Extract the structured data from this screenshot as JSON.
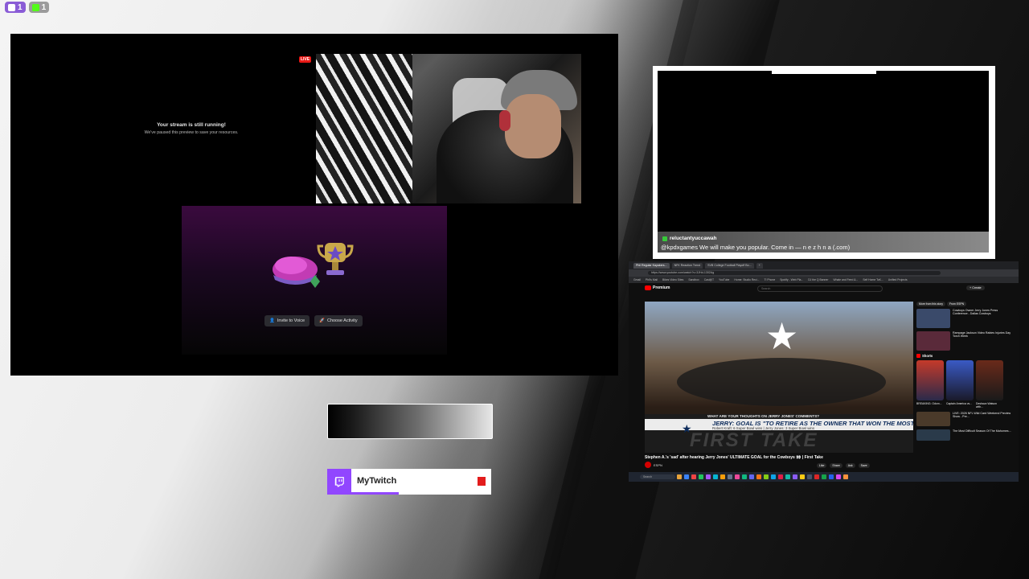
{
  "top_badges": [
    {
      "platform": "twitch",
      "count": "1"
    },
    {
      "platform": "kick",
      "count": "1"
    }
  ],
  "discord_panel": {
    "paused_title": "Your stream is still running!",
    "paused_sub": "We've paused this preview to save your resources.",
    "live_badge": "LIVE",
    "invite_button": "Invite to Voice",
    "choose_activity_button": "Choose Activity"
  },
  "chat": {
    "username": "reluctantyuccawah",
    "message": "@kpdxgames We will make you popular. Come in — n e z h n a (.com)"
  },
  "browser": {
    "tabs": [
      "Phil Regular Kayakers...",
      "NFK Reaction Trend",
      "SVB College Football Playoff Bo...",
      "+"
    ],
    "url": "https://www.youtube.com/watch?v=3JHd-1302Ag",
    "bookmarks": [
      "Gmail",
      "Phil's Mail",
      "Bikes Video Sites",
      "Sandbox",
      "Casl@T",
      "YouTube",
      "Home: Studio Reci...",
      "T! Phone",
      "Spotify - Web Pla...",
      "DJ the Q Banner",
      "Whale and Feed &...",
      "Self Home ToK...",
      "Unified Projects"
    ],
    "yt_brand": "Premium",
    "search_placeholder": "Search",
    "create_label": "+ Create",
    "lower_third": {
      "top_label": "WHAT ARE YOUR THOUGHTS ON JERRY JONES' COMMENTS?",
      "headline": "JERRY: GOAL IS \"TO RETIRE AS THE OWNER THAT WON THE MOST SUPER BOWLS\"",
      "sub": "Robert Kraft: 6 Super Bowl wins  |  Jerry Jones: 3 Super Bowl wins",
      "show": "FIRST TAKE"
    },
    "video_title": "Stephen A.'s 'sad' after hearing Jerry Jones' ULTIMATE GOAL for the Cowboys 👀 | First Take",
    "channel": "ESPN",
    "actions": [
      "Like",
      "Share",
      "Ask",
      "Save"
    ],
    "sidebar_chips": [
      "More from this story",
      "From ESPN"
    ],
    "sidebar_items": [
      {
        "title": "Cowboys Owner Jerry Jones Press Conference - Dallas Cowboys"
      },
      {
        "title": "Rampage Jackson Video Rabies Injuries Day Torch Week"
      }
    ],
    "shorts_label": "Shorts",
    "shorts": [
      {
        "label": "BREAKING: Odom..."
      },
      {
        "label": "Captain America vs..."
      },
      {
        "label": "Deshaun Watson with..."
      }
    ],
    "more_items": [
      {
        "title": "LIVE: 2026 NFL Wild Card Weekend Preview Show - Pre..."
      },
      {
        "title": "The Most Difficult Season Of The Mahomes..."
      }
    ],
    "taskbar_search": "Search",
    "taskbar_colors": [
      "#e8a33a",
      "#3b82f6",
      "#ef4444",
      "#22c55e",
      "#a855f7",
      "#06b6d4",
      "#f59e0b",
      "#64748b",
      "#ec4899",
      "#10b981",
      "#6366f1",
      "#f97316",
      "#84cc16",
      "#0ea5e9",
      "#e11d48",
      "#14b8a6",
      "#8b5cf6",
      "#facc15",
      "#475569",
      "#dc2626",
      "#16a34a",
      "#2563eb",
      "#d946ef",
      "#fb923c"
    ]
  },
  "twitch_widget": {
    "name": "MyTwitch"
  }
}
